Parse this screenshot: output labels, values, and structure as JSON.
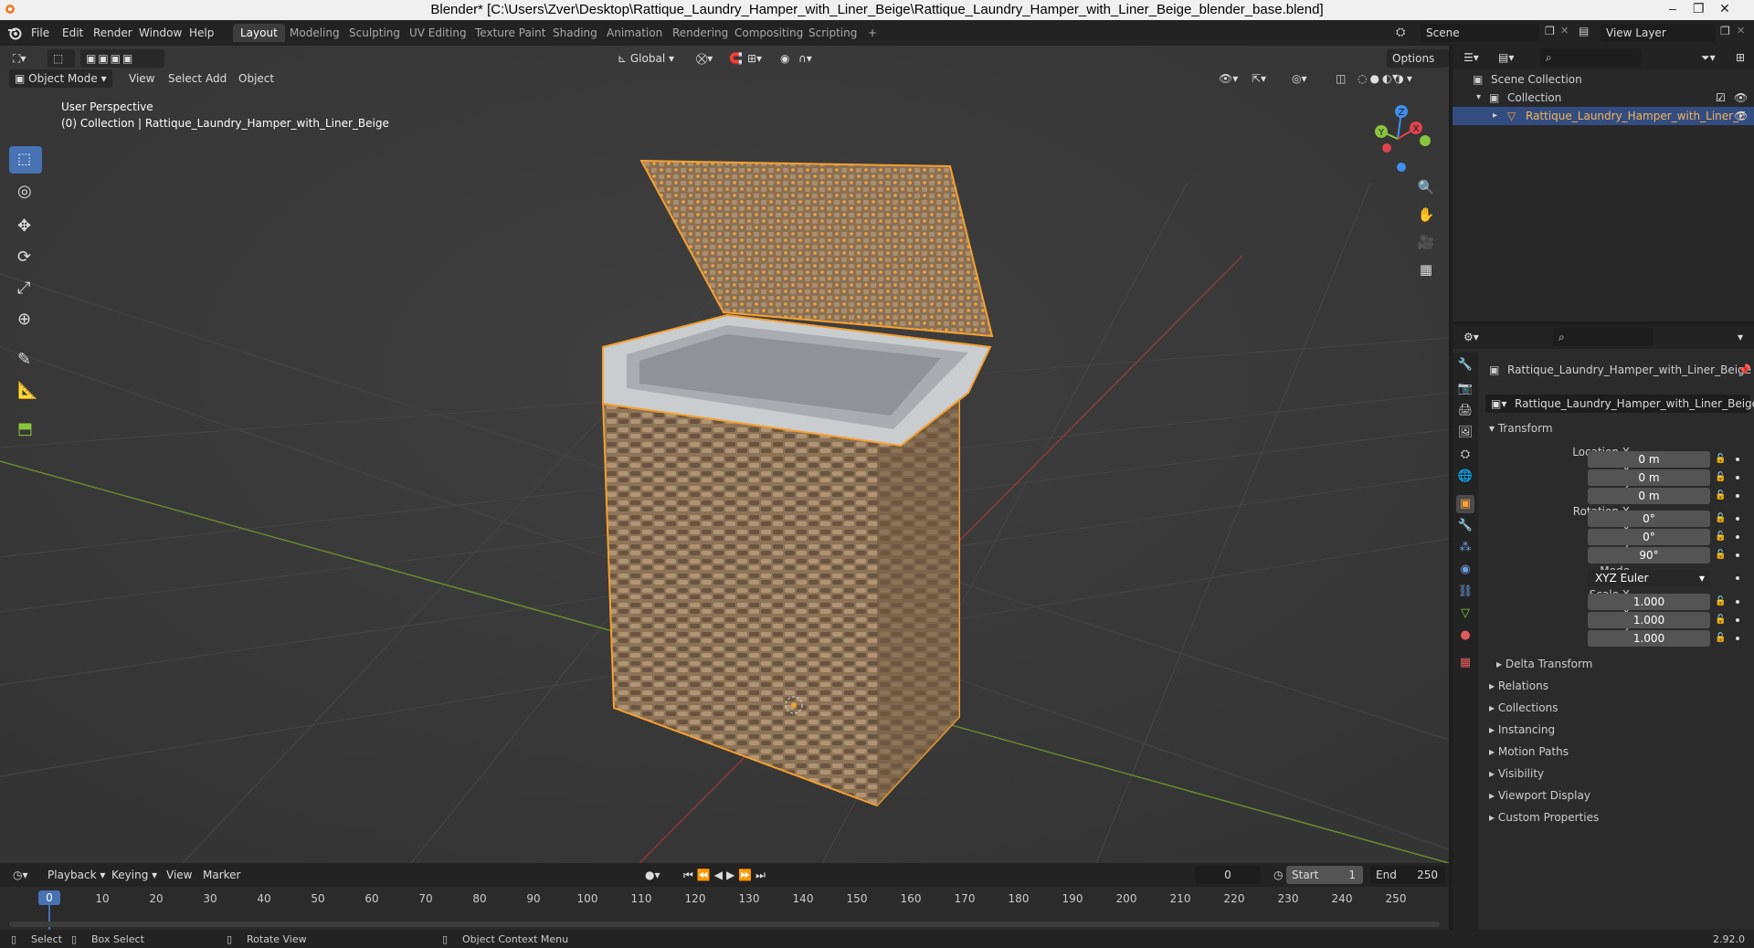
{
  "window": {
    "title": "Blender* [C:\\Users\\Zver\\Desktop\\Rattique_Laundry_Hamper_with_Liner_Beige\\Rattique_Laundry_Hamper_with_Liner_Beige_blender_base.blend]"
  },
  "menu": [
    "File",
    "Edit",
    "Render",
    "Window",
    "Help"
  ],
  "workspaces": [
    "Layout",
    "Modeling",
    "Sculpting",
    "UV Editing",
    "Texture Paint",
    "Shading",
    "Animation",
    "Rendering",
    "Compositing",
    "Scripting",
    "+"
  ],
  "top_right": {
    "scene": "Scene",
    "view_layer": "View Layer"
  },
  "viewport": {
    "mode": "Object Mode",
    "menus": [
      "View",
      "Select",
      "Add",
      "Object"
    ],
    "transform_orientation": "Global",
    "options_label": "Options",
    "info_line1": "User Perspective",
    "info_line2": "(0) Collection | Rattique_Laundry_Hamper_with_Liner_Beige",
    "gizmo": {
      "x": "X",
      "y": "Y",
      "z": "Z"
    }
  },
  "timeline": {
    "menus": [
      "Playback",
      "Keying",
      "View",
      "Marker"
    ],
    "current_frame": "0",
    "start_label": "Start",
    "start_value": "1",
    "end_label": "End",
    "end_value": "250",
    "frame_marker": "0",
    "ticks": [
      "10",
      "20",
      "30",
      "40",
      "50",
      "60",
      "70",
      "80",
      "90",
      "100",
      "110",
      "120",
      "130",
      "140",
      "150",
      "160",
      "170",
      "180",
      "190",
      "200",
      "210",
      "220",
      "230",
      "240",
      "250"
    ]
  },
  "statusbar": {
    "select": "Select",
    "box_select": "Box Select",
    "rotate": "Rotate View",
    "context": "Object Context Menu",
    "version": "2.92.0"
  },
  "outliner": {
    "scene_collection": "Scene Collection",
    "collection": "Collection",
    "object": "Rattique_Laundry_Hamper_with_Liner_E"
  },
  "properties": {
    "object_name": "Rattique_Laundry_Hamper_with_Liner_Beige",
    "datablock_name": "Rattique_Laundry_Hamper_with_Liner_Beige",
    "transform_label": "Transform",
    "location_x_label": "Location X",
    "location_x": "0 m",
    "location_y_label": "Y",
    "location_y": "0 m",
    "location_z_label": "Z",
    "location_z": "0 m",
    "rotation_x_label": "Rotation X",
    "rotation_x": "0°",
    "rotation_y_label": "Y",
    "rotation_y": "0°",
    "rotation_z_label": "Z",
    "rotation_z": "90°",
    "mode_label": "Mode",
    "mode_value": "XYZ Euler",
    "scale_x_label": "Scale X",
    "scale_x": "1.000",
    "scale_y_label": "Y",
    "scale_y": "1.000",
    "scale_z_label": "Z",
    "scale_z": "1.000",
    "delta_transform": "Delta Transform",
    "sections": [
      "Relations",
      "Collections",
      "Instancing",
      "Motion Paths",
      "Visibility",
      "Viewport Display",
      "Custom Properties"
    ]
  },
  "colors": {
    "accent": "#4772b3",
    "selection": "#f5a030",
    "x_axis": "#e0434f",
    "y_axis": "#8ac53e",
    "z_axis": "#3f8ff0"
  }
}
